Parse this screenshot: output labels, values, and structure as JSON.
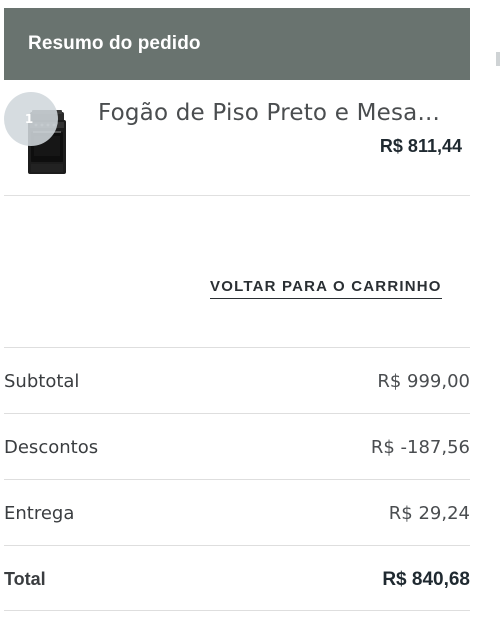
{
  "summary": {
    "header_title": "Resumo do pedido",
    "colors": {
      "header_bg": "#69736f",
      "badge_bg": "#d0d7dc"
    }
  },
  "product": {
    "quantity": "1",
    "name": "Fogão de Piso Preto e Mesa...",
    "price": "R$ 811,44",
    "image_icon": "stove-product-icon"
  },
  "back_link": {
    "label": "VOLTAR PARA O CARRINHO"
  },
  "totals": {
    "rows": [
      {
        "label": "Subtotal",
        "value": "R$ 999,00"
      },
      {
        "label": "Descontos",
        "value": "R$ -187,56"
      },
      {
        "label": "Entrega",
        "value": "R$ 29,24"
      },
      {
        "label": "Total",
        "value": "R$ 840,68"
      }
    ]
  }
}
